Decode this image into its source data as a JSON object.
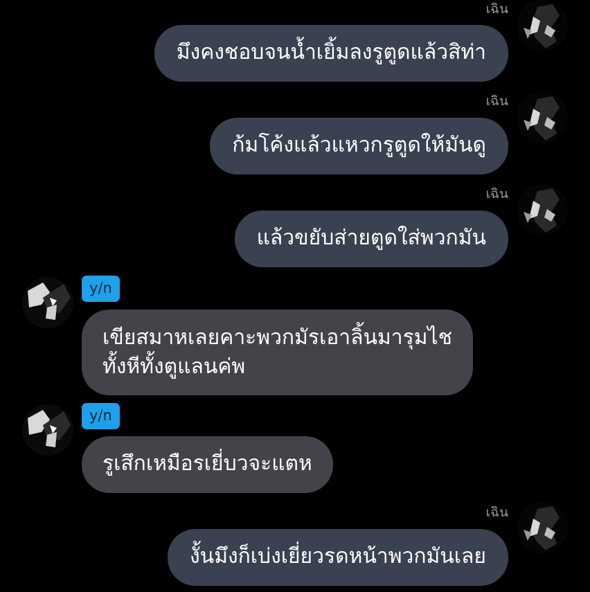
{
  "conversation": {
    "messages": [
      {
        "sender": "เฉิน",
        "side": "right",
        "text": "มึงคงชอบจนน้ำเยิ้มลงรูตูดแล้วสิท่า"
      },
      {
        "sender": "เฉิน",
        "side": "right",
        "text": "ก้มโค้งแล้วแหวกรูตูดให้มันดู"
      },
      {
        "sender": "เฉิน",
        "side": "right",
        "text": "แล้วขยับส่ายตูดใส่พวกมัน"
      },
      {
        "sender": "y/n",
        "side": "left",
        "lines": [
          "เขียสมาหเลยคาะพวกมัรเอาลิ้นมารุมไช",
          "ทั้งหีทั้งตูแลนค่พ"
        ]
      },
      {
        "sender": "y/n",
        "side": "left",
        "text": "รูเสึกเหมือรเยี่บวจะแตห"
      },
      {
        "sender": "เฉิน",
        "side": "right",
        "text": "งั้นมึงก็เบ่งเยี่ยวรดหน้าพวกมันเลย"
      }
    ]
  },
  "colors": {
    "background": "#000000",
    "right_bubble": "#3a4150",
    "left_bubble": "#434449",
    "name_tag": "#1ea0ea",
    "sender_name": "#9a9a9a"
  }
}
